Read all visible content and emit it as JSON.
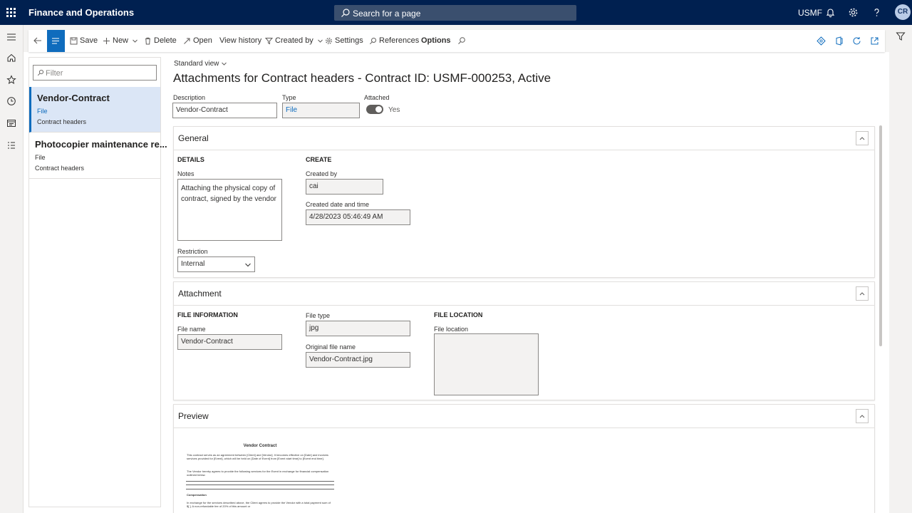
{
  "topbar": {
    "app_name": "Finance and Operations",
    "search_placeholder": "Search for a page",
    "company": "USMF",
    "avatar_initials": "CR"
  },
  "actions": {
    "save": "Save",
    "new": "New",
    "delete": "Delete",
    "open": "Open",
    "view_history": "View history",
    "created_by": "Created by",
    "settings": "Settings",
    "references": "References",
    "options": "Options"
  },
  "list": {
    "filter_placeholder": "Filter",
    "items": [
      {
        "title": "Vendor-Contract",
        "type": "File",
        "table": "Contract headers"
      },
      {
        "title": "Photocopier maintenance re...",
        "type": "File",
        "table": "Contract headers"
      }
    ]
  },
  "header": {
    "view": "Standard view",
    "title": "Attachments for Contract headers - Contract ID: USMF-000253, Active",
    "description_label": "Description",
    "description_value": "Vendor-Contract",
    "type_label": "Type",
    "type_value": "File",
    "attached_label": "Attached",
    "attached_value": "Yes"
  },
  "general": {
    "title": "General",
    "details_heading": "DETAILS",
    "notes_label": "Notes",
    "notes_value": "Attaching the physical copy of contract, signed by the vendor",
    "restriction_label": "Restriction",
    "restriction_value": "Internal",
    "create_heading": "CREATE",
    "created_by_label": "Created by",
    "created_by_value": "cai",
    "created_dt_label": "Created date and time",
    "created_dt_value": "4/28/2023 05:46:49 AM"
  },
  "attachment": {
    "title": "Attachment",
    "file_info_heading": "FILE INFORMATION",
    "file_name_label": "File name",
    "file_name_value": "Vendor-Contract",
    "file_type_label": "File type",
    "file_type_value": "jpg",
    "original_name_label": "Original file name",
    "original_name_value": "Vendor-Contract.jpg",
    "file_location_heading": "FILE LOCATION",
    "file_location_label": "File location"
  },
  "preview": {
    "title": "Preview",
    "doc_title": "Vendor Contract",
    "doc_p1": "This contract serves as an agreement between [Client] and [Vendor]. It becomes effective on [Date] and involves services provided for [Event], which will be held on [Date of Event] from [Event start time] to [Event end time].",
    "doc_p2": "The Vendor hereby agrees to provide the following services for the Event in exchange for financial compensation outlined below.",
    "doc_h2": "Compensation",
    "doc_p3": "In exchange for the services described above, the Client agrees to provide the Vendor with a total payment sum of $[          ]. A non-refundable fee of 20% of this amount or"
  }
}
